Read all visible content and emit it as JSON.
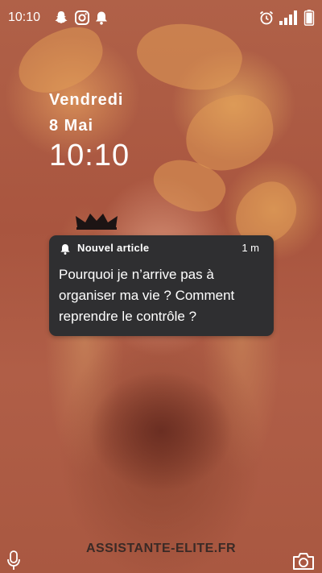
{
  "status_bar": {
    "time": "10:10",
    "left_icons": [
      "snapchat-icon",
      "instagram-icon",
      "bell-icon"
    ],
    "right_icons": [
      "alarm-icon",
      "signal-icon",
      "battery-icon"
    ]
  },
  "lockscreen": {
    "day": "Vendredi",
    "date": "8 Mai",
    "time": "10:10"
  },
  "notification": {
    "icon": "bell-icon",
    "title": "Nouvel article",
    "age": "1 m",
    "body": "Pourquoi je n’arrive pas à organiser ma vie ? Comment reprendre le contrôle ?"
  },
  "bottom": {
    "brand": "ASSISTANTE-ELITE.FR",
    "left_icon": "microphone-icon",
    "right_icon": "camera-icon"
  },
  "colors": {
    "background_tint": "#b5654a",
    "notification_bg": "#2f2f31",
    "text_light": "#ffffff",
    "brand_text": "#3a2a26"
  }
}
